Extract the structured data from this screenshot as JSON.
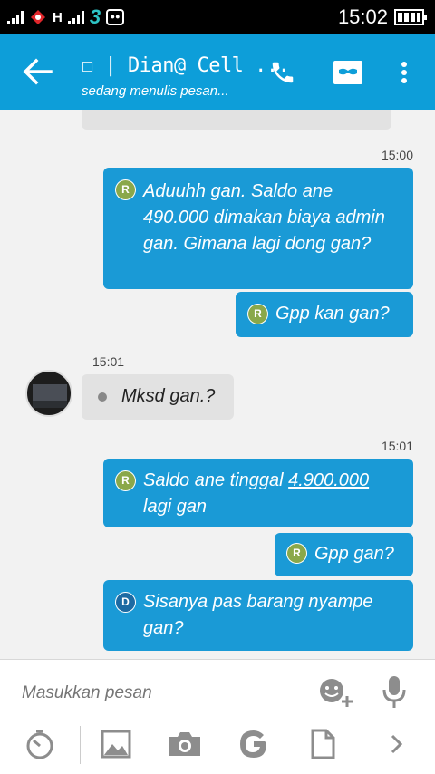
{
  "status_bar": {
    "time": "15:02",
    "carrier_badge": "3",
    "network_badge": "H",
    "bbm_icon": "bbm-icon"
  },
  "header": {
    "title": "☐ | Dian@ Cell ...",
    "subtitle": "sedang menulis pesan...",
    "icons": [
      "back-arrow-icon",
      "phone-icon",
      "video-chat-icon",
      "more-vert-icon"
    ]
  },
  "messages": [
    {
      "dir": "in",
      "text": "...",
      "partial": true
    },
    {
      "dir": "out",
      "time": "15:00",
      "status": "R",
      "text": "Aduuhh gan. Saldo ane 490.000 dimakan biaya admin gan. Gimana lagi dong gan?"
    },
    {
      "dir": "out",
      "status": "R",
      "text": "Gpp kan gan?"
    },
    {
      "dir": "in",
      "time": "15:01",
      "text": "Mksd gan.?"
    },
    {
      "dir": "out",
      "time": "15:01",
      "status": "R",
      "text_before": "Saldo ane tinggal ",
      "link": "4.900.000",
      "text_after": " lagi gan"
    },
    {
      "dir": "out",
      "status": "R",
      "text": "Gpp gan?"
    },
    {
      "dir": "out",
      "status": "D",
      "text": "Sisanya pas barang nyampe gan?"
    }
  ],
  "composer": {
    "placeholder": "Masukkan pesan",
    "icons": [
      "emoji-add-icon",
      "microphone-icon"
    ]
  },
  "toolbar": {
    "icons": [
      "timer-icon",
      "image-icon",
      "camera-icon",
      "google-icon",
      "document-icon",
      "chevron-right-icon"
    ]
  },
  "colors": {
    "app_bar": "#0d9ed9",
    "bubble_out": "#1a9ad6",
    "bubble_in": "#e2e2e2",
    "read_badge": "#8aa84a",
    "delivered_badge": "#1c6aa3"
  }
}
